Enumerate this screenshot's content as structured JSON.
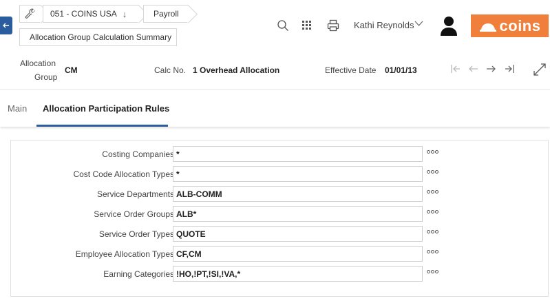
{
  "breadcrumb": {
    "company": "051 - COINS USA",
    "module": "Payroll",
    "page": "Allocation Group Calculation Summary"
  },
  "header": {
    "user_name": "Kathi Reynolds",
    "logo_text": "coins"
  },
  "form": {
    "allocation_group_label_line1": "Allocation",
    "allocation_group_label_line2": "Group",
    "allocation_group_value": "CM",
    "calc_no_label": "Calc No.",
    "calc_no_value": "1 Overhead Allocation",
    "effective_date_label": "Effective Date",
    "effective_date_value": "01/01/13"
  },
  "tabs": [
    {
      "label": "Main"
    },
    {
      "label": "Allocation Participation Rules"
    }
  ],
  "rules": [
    {
      "label": "Costing Companies",
      "value": "*"
    },
    {
      "label": "Cost Code Allocation Types",
      "value": "*"
    },
    {
      "label": "Service Departments",
      "value": "ALB-COMM"
    },
    {
      "label": "Service Order Groups",
      "value": "ALB*"
    },
    {
      "label": "Service Order Types",
      "value": "QUOTE"
    },
    {
      "label": "Employee Allocation Types",
      "value": "CF,CM"
    },
    {
      "label": "Earning Categories",
      "value": "!HO,!PT,!SI,!VA,*"
    }
  ],
  "colors": {
    "accent": "#2b5d9e",
    "brand": "#f07f3c"
  },
  "icons": {
    "back": "arrow-left-icon",
    "wrench": "wrench-icon",
    "company_dropdown": "arrow-down-icon",
    "search": "search-icon",
    "apps": "grid-icon",
    "print": "printer-icon",
    "user_menu": "chevron-down-icon",
    "avatar": "user-avatar-icon",
    "first": "first-record-icon",
    "prev": "previous-record-icon",
    "next": "next-record-icon",
    "last": "last-record-icon",
    "expand": "expand-icon",
    "lookup": "more-options-icon"
  }
}
